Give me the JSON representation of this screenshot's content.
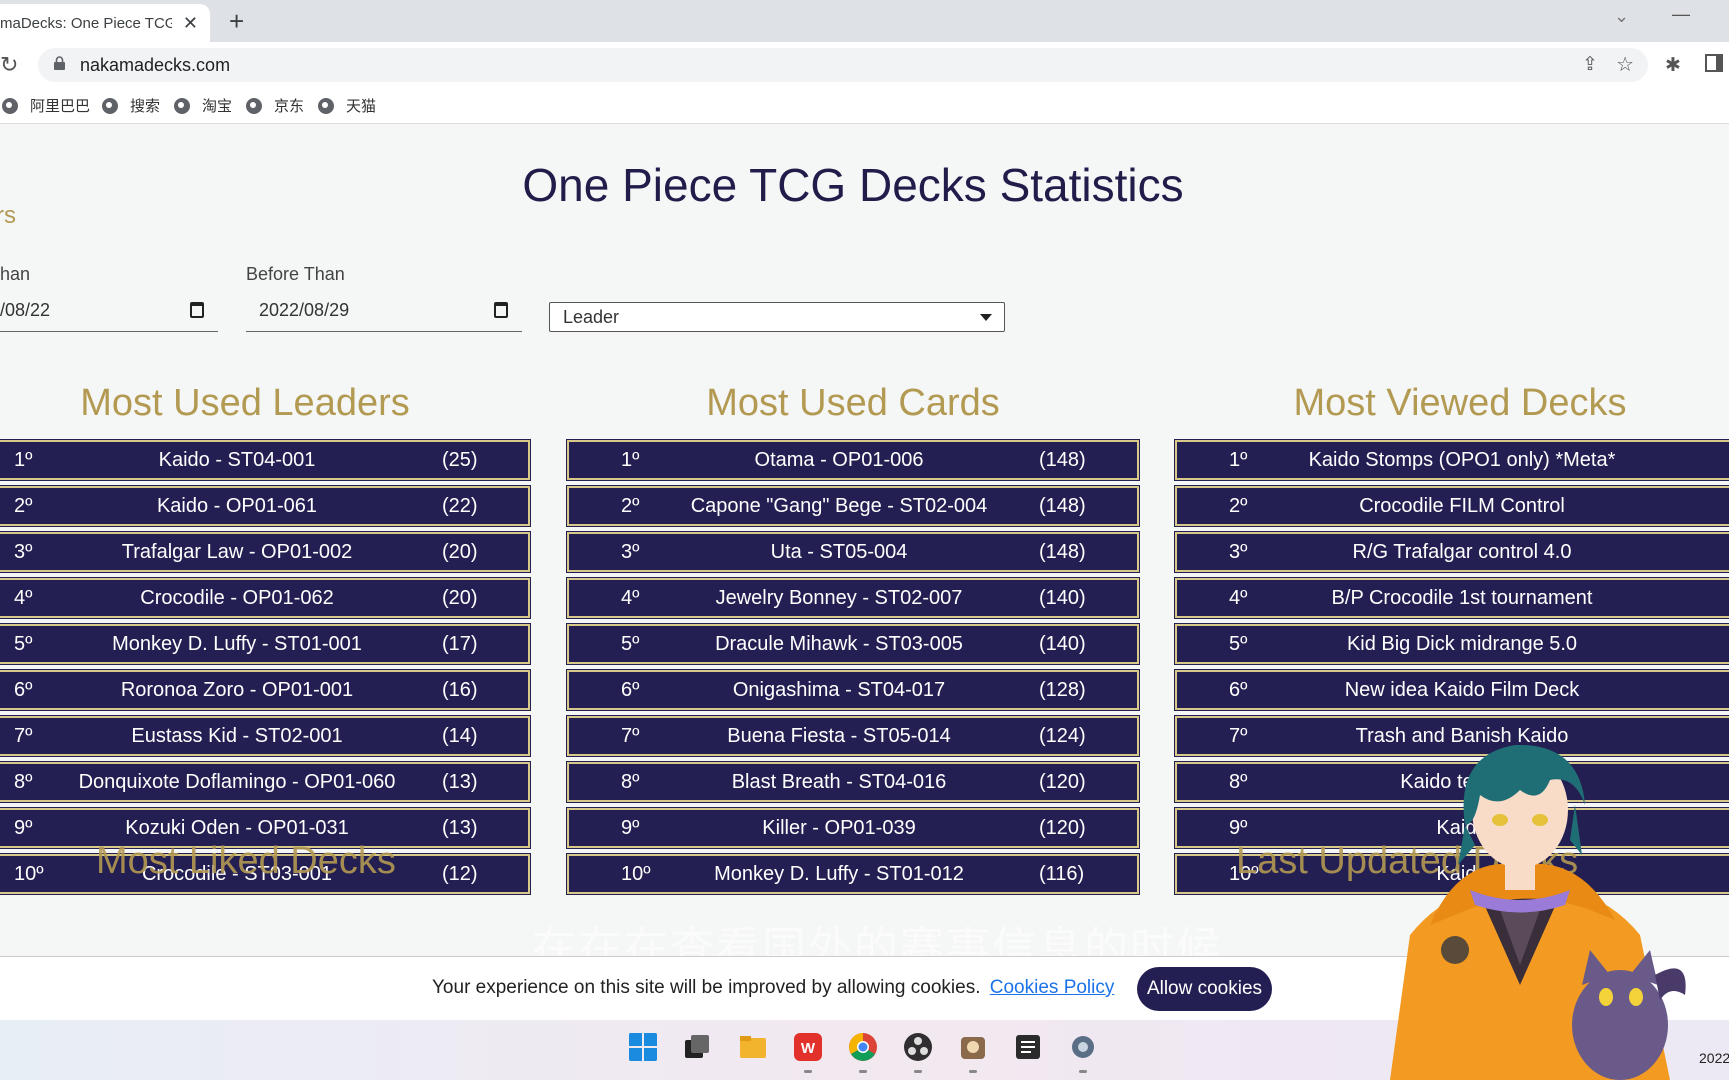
{
  "browser": {
    "tab_title": "maDecks: One Piece TCG",
    "url": "nakamadecks.com",
    "bookmarks": [
      "阿里巴巴",
      "搜索",
      "淘宝",
      "京东",
      "天猫"
    ]
  },
  "page": {
    "title": "One Piece TCG Decks Statistics",
    "filters_heading": "rs",
    "after_label": "han",
    "after_value": "/08/22",
    "before_label": "Before Than",
    "before_value": "2022/08/29",
    "filter_select": "Leader"
  },
  "leaders": {
    "title": "Most Used Leaders",
    "rows": [
      {
        "pos": "1º",
        "name": "Kaido - ST04-001",
        "count": "(25)"
      },
      {
        "pos": "2º",
        "name": "Kaido - OP01-061",
        "count": "(22)"
      },
      {
        "pos": "3º",
        "name": "Trafalgar Law - OP01-002",
        "count": "(20)"
      },
      {
        "pos": "4º",
        "name": "Crocodile - OP01-062",
        "count": "(20)"
      },
      {
        "pos": "5º",
        "name": "Monkey D. Luffy - ST01-001",
        "count": "(17)"
      },
      {
        "pos": "6º",
        "name": "Roronoa Zoro - OP01-001",
        "count": "(16)"
      },
      {
        "pos": "7º",
        "name": "Eustass Kid - ST02-001",
        "count": "(14)"
      },
      {
        "pos": "8º",
        "name": "Donquixote Doflamingo - OP01-060",
        "count": "(13)"
      },
      {
        "pos": "9º",
        "name": "Kozuki Oden - OP01-031",
        "count": "(13)"
      },
      {
        "pos": "10º",
        "name": "Crocodile - ST03-001",
        "count": "(12)"
      }
    ]
  },
  "cards": {
    "title": "Most Used Cards",
    "rows": [
      {
        "pos": "1º",
        "name": "Otama - OP01-006",
        "count": "(148)"
      },
      {
        "pos": "2º",
        "name": "Capone \"Gang\" Bege - ST02-004",
        "count": "(148)"
      },
      {
        "pos": "3º",
        "name": "Uta - ST05-004",
        "count": "(148)"
      },
      {
        "pos": "4º",
        "name": "Jewelry Bonney - ST02-007",
        "count": "(140)"
      },
      {
        "pos": "5º",
        "name": "Dracule Mihawk - ST03-005",
        "count": "(140)"
      },
      {
        "pos": "6º",
        "name": "Onigashima - ST04-017",
        "count": "(128)"
      },
      {
        "pos": "7º",
        "name": "Buena Fiesta - ST05-014",
        "count": "(124)"
      },
      {
        "pos": "8º",
        "name": "Blast Breath - ST04-016",
        "count": "(120)"
      },
      {
        "pos": "9º",
        "name": "Killer - OP01-039",
        "count": "(120)"
      },
      {
        "pos": "10º",
        "name": "Monkey D. Luffy - ST01-012",
        "count": "(116)"
      }
    ]
  },
  "decks": {
    "title": "Most Viewed Decks",
    "rows": [
      {
        "pos": "1º",
        "name": "Kaido Stomps (OPO1 only) *Meta*"
      },
      {
        "pos": "2º",
        "name": "Crocodile FILM Control"
      },
      {
        "pos": "3º",
        "name": "R/G Trafalgar control 4.0"
      },
      {
        "pos": "4º",
        "name": "B/P Crocodile 1st tournament"
      },
      {
        "pos": "5º",
        "name": "Kid Big Dick midrange 5.0"
      },
      {
        "pos": "6º",
        "name": "New idea Kaido Film Deck"
      },
      {
        "pos": "7º",
        "name": "Trash and Banish Kaido"
      },
      {
        "pos": "8º",
        "name": "Kaido temp                  .0"
      },
      {
        "pos": "9º",
        "name": "Kaido"
      },
      {
        "pos": "10º",
        "name": "Kaido"
      }
    ]
  },
  "lower_titles": {
    "left": "Most Liked Decks",
    "right": "Last Updated Decks"
  },
  "cookie": {
    "text": "Your experience on this site will be improved by allowing cookies.",
    "link": "Cookies Policy",
    "button": "Allow cookies"
  },
  "overlay": {
    "subtitle": "在在在查看国外的赛事信息的时候"
  },
  "taskbar": {
    "clock": "2022"
  },
  "colors": {
    "navy": "#241f52",
    "gold": "#b39a52",
    "border_gold": "#d8c98b"
  }
}
